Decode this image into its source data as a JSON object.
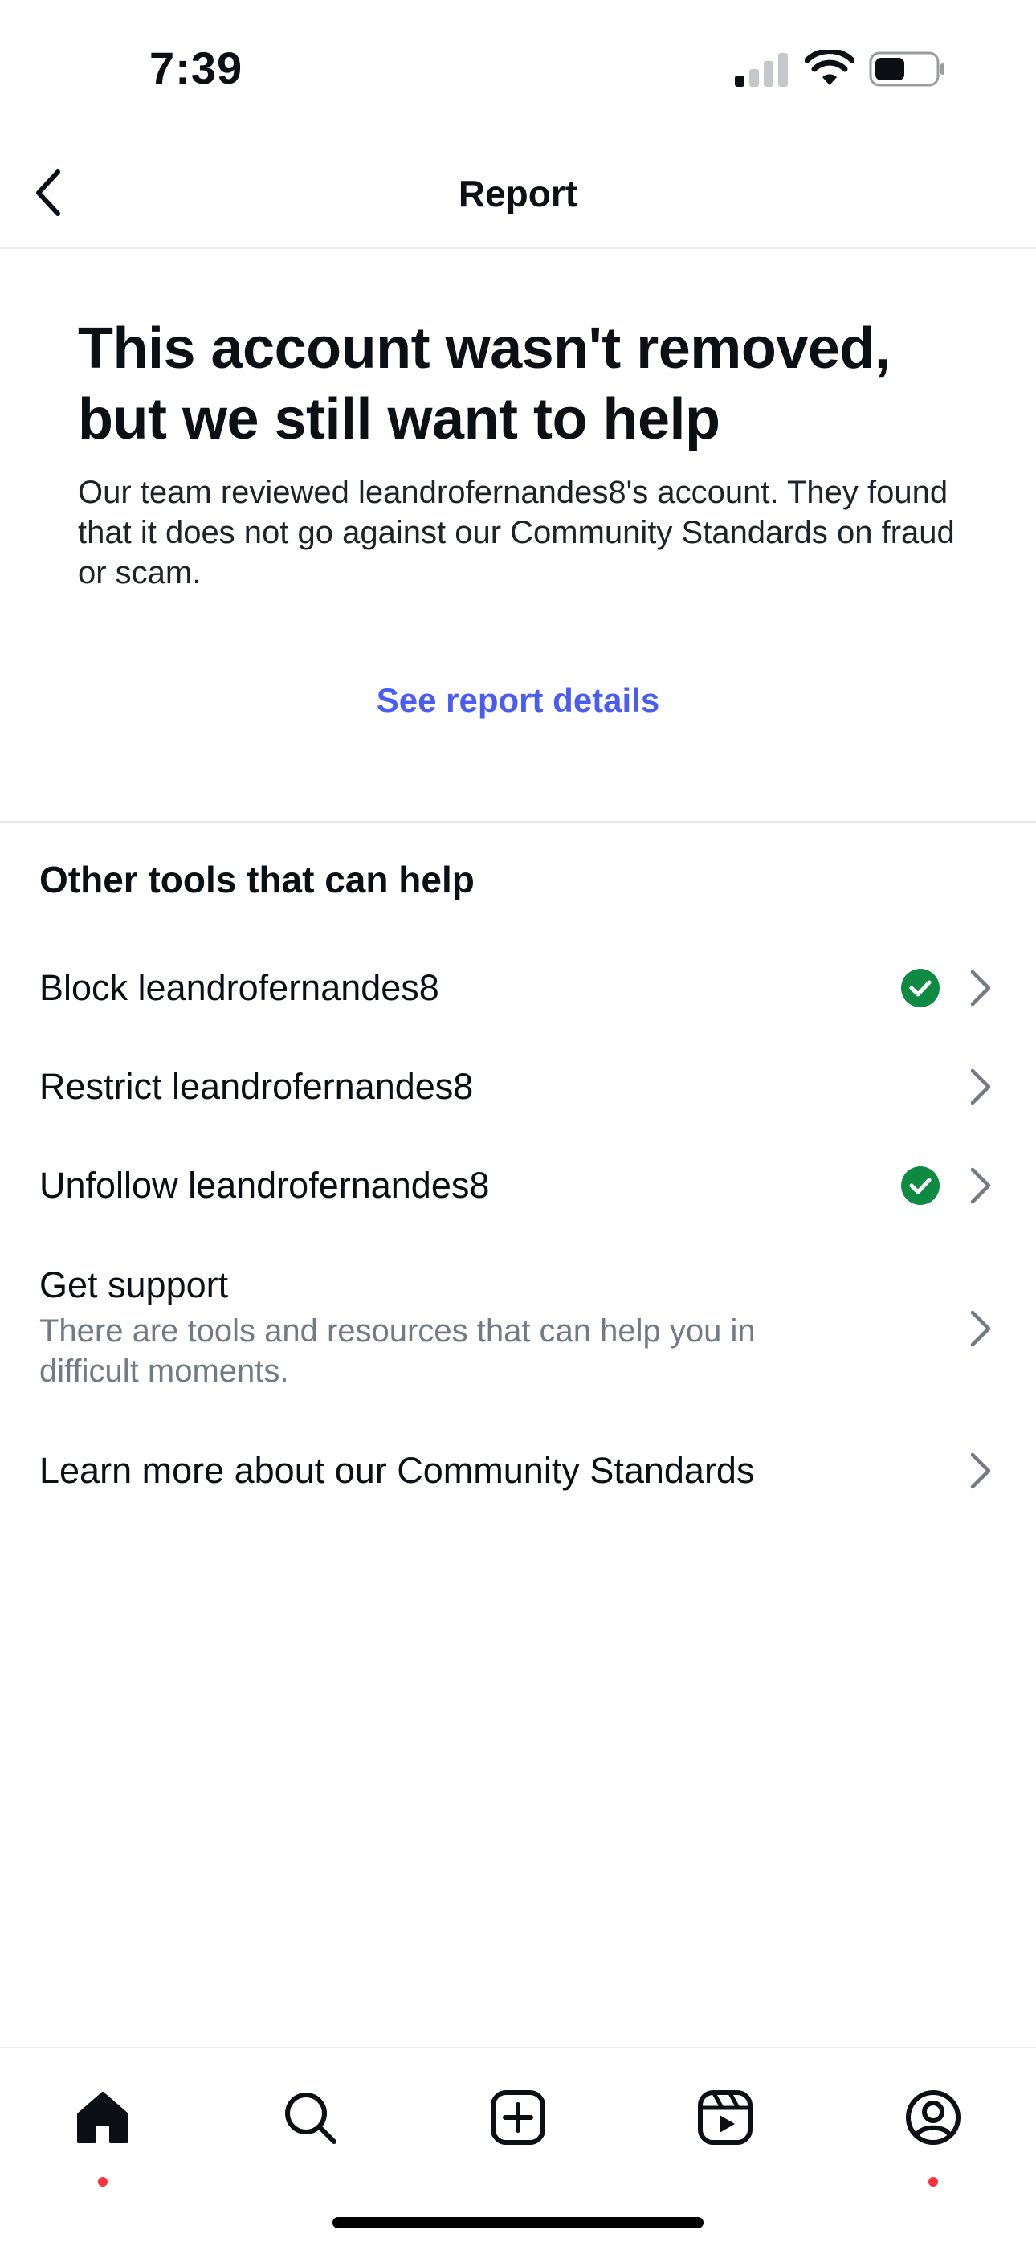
{
  "status_bar": {
    "time": "7:39"
  },
  "header": {
    "title": "Report"
  },
  "hero": {
    "title": "This account wasn't removed, but we still want to help",
    "description": "Our team reviewed leandrofernandes8's account. They found that it does not go against our Community Standards on fraud or scam.",
    "link": "See report details"
  },
  "tools": {
    "heading": "Other tools that can help",
    "items": [
      {
        "label": "Block leandrofernandes8",
        "checked": true
      },
      {
        "label": "Restrict leandrofernandes8",
        "checked": false
      },
      {
        "label": "Unfollow leandrofernandes8",
        "checked": true
      },
      {
        "label": "Get support",
        "sublabel": "There are tools and resources that can help you in difficult moments.",
        "checked": false
      },
      {
        "label": "Learn more about our Community Standards",
        "checked": false
      }
    ]
  },
  "tab_bar": {
    "tabs": [
      {
        "name": "home-icon",
        "notification": true
      },
      {
        "name": "search-icon",
        "notification": false
      },
      {
        "name": "create-icon",
        "notification": false
      },
      {
        "name": "reels-icon",
        "notification": false
      },
      {
        "name": "profile-icon",
        "notification": true
      }
    ]
  },
  "colors": {
    "link": "#4a5df0",
    "check": "#0f8a43",
    "notification_dot": "#ff3040",
    "subtext": "#737a85"
  }
}
